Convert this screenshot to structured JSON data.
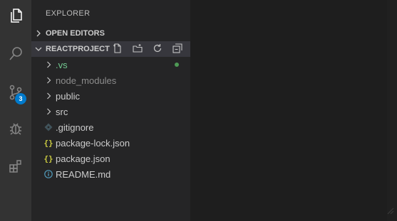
{
  "activity_bar": {
    "items": [
      {
        "name": "explorer",
        "icon": "files-icon",
        "active": true
      },
      {
        "name": "search",
        "icon": "search-icon"
      },
      {
        "name": "source-control",
        "icon": "source-control-icon",
        "badge": "3"
      },
      {
        "name": "debug",
        "icon": "debug-icon"
      },
      {
        "name": "extensions",
        "icon": "extensions-icon"
      }
    ]
  },
  "sidebar": {
    "title": "EXPLORER",
    "open_editors_label": "OPEN EDITORS",
    "project_label": "REACTPROJECT",
    "actions": [
      "new-file-icon",
      "new-folder-icon",
      "refresh-icon",
      "collapse-all-icon"
    ],
    "tree": [
      {
        "label": ".vs",
        "type": "folder",
        "status": "modified"
      },
      {
        "label": "node_modules",
        "type": "folder",
        "status": "ignored"
      },
      {
        "label": "public",
        "type": "folder"
      },
      {
        "label": "src",
        "type": "folder"
      },
      {
        "label": ".gitignore",
        "type": "file",
        "icon": "git-file-icon"
      },
      {
        "label": "package-lock.json",
        "type": "file",
        "icon": "json-icon",
        "glyph": "{}"
      },
      {
        "label": "package.json",
        "type": "file",
        "icon": "json-icon",
        "glyph": "{}"
      },
      {
        "label": "README.md",
        "type": "file",
        "icon": "info-icon"
      }
    ]
  },
  "colors": {
    "activity_bar": "#333333",
    "sidebar": "#252526",
    "editor": "#1e1e1e",
    "badge": "#007acc",
    "json_icon": "#cbcb41",
    "info_icon": "#519aba",
    "modified_text": "#73c991",
    "modified_dot": "#4e9a55"
  }
}
